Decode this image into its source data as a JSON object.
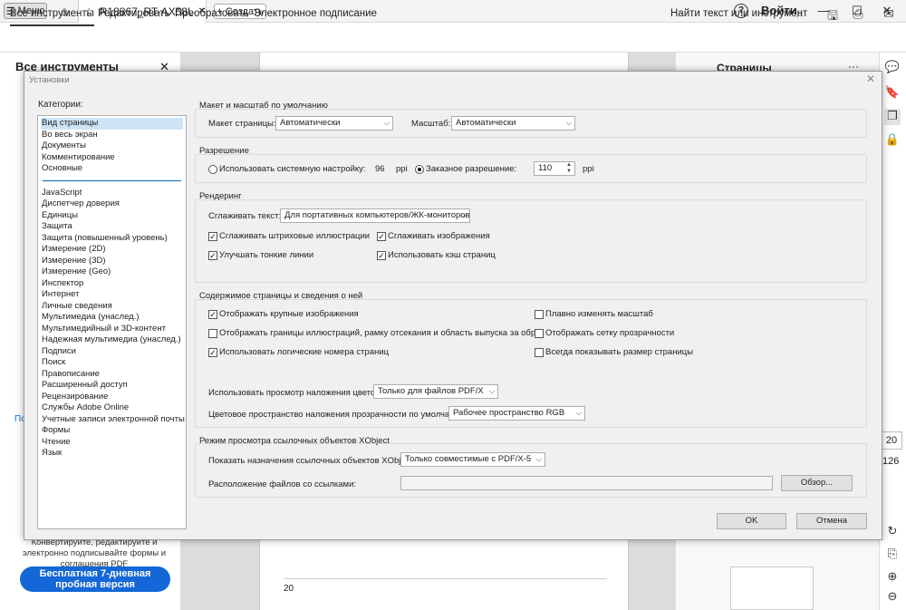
{
  "titlebar": {
    "menu_label": "Меню",
    "doc_tab": "R18867_RT-AX58U...",
    "new_label": "Создать",
    "help": "?",
    "signin": "Войти",
    "min": "—",
    "max": "☐",
    "close": "✕",
    "tab_close": "✕"
  },
  "toolbar": {
    "tabs": [
      "Все инструменты",
      "Редактировать",
      "Преобразовать",
      "Электронное подписание"
    ],
    "find": "Найти текст или инструмент"
  },
  "leftpane": {
    "title": "Все инструменты",
    "close": "✕",
    "promo": "Конвертируйте, редактируйте и электронно подписывайте формы и соглашения PDF",
    "trial": "Бесплатная 7-дневная пробная версия",
    "partial1": "Пс"
  },
  "page": {
    "axis_num": "20"
  },
  "rightpane": {
    "title": "Страницы",
    "dots": "···"
  },
  "rightbar": {
    "zoom": "20",
    "count": "126"
  },
  "dialog": {
    "title": "Установки",
    "close": "✕",
    "categories_label": "Категории:",
    "categories_top": [
      "Вид страницы",
      "Во весь экран",
      "Документы",
      "Комментирование",
      "Основные"
    ],
    "categories": [
      "JavaScript",
      "Диспетчер доверия",
      "Единицы",
      "Защита",
      "Защита (повышенный уровень)",
      "Измерение (2D)",
      "Измерение (3D)",
      "Измерение (Geo)",
      "Инспектор",
      "Интернет",
      "Личные сведения",
      "Мультимедиа (унаслед.)",
      "Мультимедийный и 3D-контент",
      "Надежная мультимедиа (унаслед.)",
      "Подписи",
      "Поиск",
      "Правописание",
      "Расширенный доступ",
      "Рецензирование",
      "Службы Adobe Online",
      "Учетные записи электронной почты",
      "Формы",
      "Чтение",
      "Язык"
    ],
    "layout": {
      "title": "Макет и масштаб по умолчанию",
      "layout_label": "Макет страницы:",
      "layout_value": "Автоматически",
      "zoom_label": "Масштаб:",
      "zoom_value": "Автоматически"
    },
    "resolution": {
      "title": "Разрешение",
      "system_label": "Использовать системную настройку:",
      "system_value": "96",
      "system_unit": "ppi",
      "custom_label": "Заказное разрешение:",
      "custom_value": "110",
      "custom_unit": "ppi"
    },
    "rendering": {
      "title": "Рендеринг",
      "smooth_label": "Сглаживать текст:",
      "smooth_value": "Для портативных компьютеров/ЖК-мониторов",
      "cb1": "Сглаживать штриховые иллюстрации",
      "cb2": "Сглаживать изображения",
      "cb3": "Улучшать тонкие линии",
      "cb4": "Использовать кэш страниц"
    },
    "content": {
      "title": "Содержимое страницы и сведения о ней",
      "cb1": "Отображать крупные изображения",
      "cb2": "Отображать границы иллюстраций, рамку отсекания и область выпуска за обрез",
      "cb3": "Использовать логические номера страниц",
      "cb4": "Плавно изменять масштаб",
      "cb5": "Отображать сетку прозрачности",
      "cb6": "Всегда показывать размер страницы",
      "overprint_label": "Использовать просмотр наложения цветов:",
      "overprint_value": "Только для файлов PDF/X",
      "blend_label": "Цветовое пространство наложения прозрачности по умолчанию:",
      "blend_value": "Рабочее пространство RGB"
    },
    "xobject": {
      "title": "Режим просмотра ссылочных объектов XObject",
      "show_label": "Показать назначения ссылочных объектов XObject:",
      "show_value": "Только совместимые с PDF/X-5",
      "loc_label": "Расположение файлов со ссылками:",
      "browse": "Обзор..."
    },
    "ok": "OK",
    "cancel": "Отмена"
  }
}
